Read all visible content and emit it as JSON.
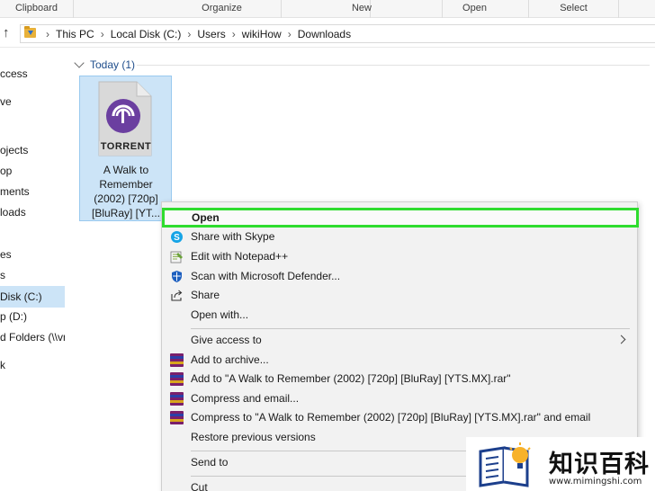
{
  "ribbon": {
    "groups": [
      "Clipboard",
      "Organize",
      "New",
      "Open",
      "Select"
    ]
  },
  "address_bar": {
    "crumbs": [
      "This PC",
      "Local Disk (C:)",
      "Users",
      "wikiHow",
      "Downloads"
    ]
  },
  "nav_pane": {
    "items": [
      "ccess",
      "ve",
      "ojects",
      "op",
      "ments",
      "loads",
      "es",
      "s",
      "Disk (C:)",
      "p (D:)",
      "d Folders (\\\\vn",
      "k"
    ],
    "selected_index": 8
  },
  "content": {
    "group_header": "Today (1)",
    "file": {
      "icon_label": "TORRENT",
      "name_lines": [
        "A Walk to",
        "Remember",
        "(2002) [720p]",
        "[BluRay] [YT..."
      ]
    }
  },
  "context_menu": {
    "items": {
      "open": "Open",
      "share_skype": "Share with Skype",
      "edit_notepad": "Edit with Notepad++",
      "scan_defender": "Scan with Microsoft Defender...",
      "share": "Share",
      "open_with": "Open with...",
      "give_access": "Give access to",
      "add_archive": "Add to archive...",
      "add_rar": "Add to \"A Walk to Remember (2002) [720p] [BluRay] [YTS.MX].rar\"",
      "compress_email": "Compress and email...",
      "compress_rar_email": "Compress to \"A Walk to Remember (2002) [720p] [BluRay] [YTS.MX].rar\" and email",
      "restore": "Restore previous versions",
      "send_to": "Send to",
      "cut": "Cut"
    },
    "highlight_color": "#2fdc2f"
  },
  "watermark": {
    "text": "知识百科",
    "url": "www.mimingshi.com"
  }
}
